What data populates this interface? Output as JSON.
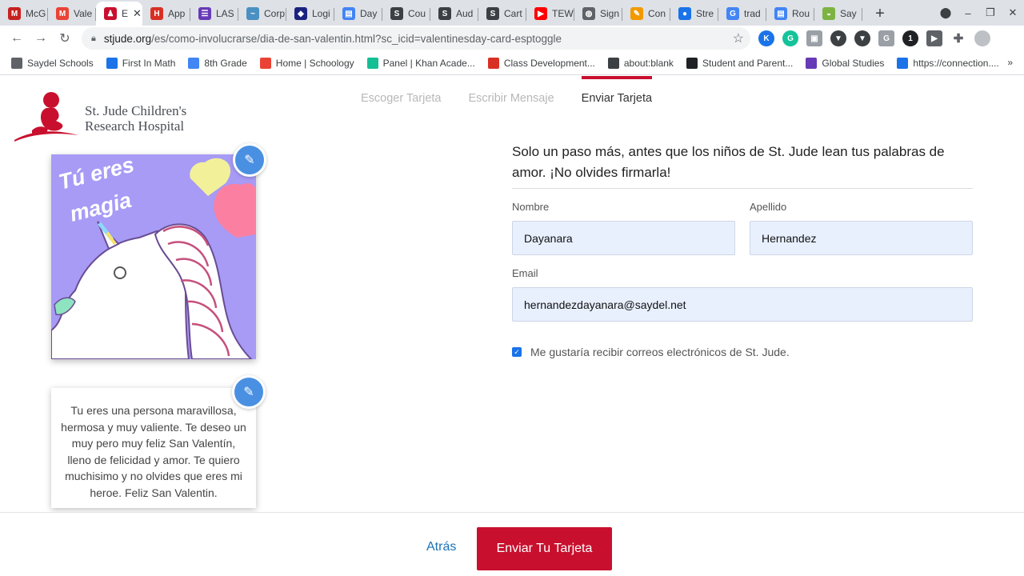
{
  "browser": {
    "tabs": [
      {
        "label": "McG",
        "icon": "mcgraw-icon",
        "color": "#c5221f",
        "glyph": "M"
      },
      {
        "label": "Vale",
        "icon": "gmail-icon",
        "color": "#ea4335",
        "glyph": "M"
      },
      {
        "label": "E",
        "icon": "stjude-icon",
        "color": "#c8102e",
        "glyph": "♟",
        "active": true
      },
      {
        "label": "App",
        "icon": "app-icon",
        "color": "#d93025",
        "glyph": "H"
      },
      {
        "label": "LAS",
        "icon": "list-icon",
        "color": "#673ab7",
        "glyph": "☰"
      },
      {
        "label": "Corp",
        "icon": "corp-icon",
        "color": "#4a90c2",
        "glyph": "~"
      },
      {
        "label": "Logi",
        "icon": "login-icon",
        "color": "#1a237e",
        "glyph": "◆"
      },
      {
        "label": "Day",
        "icon": "docs-icon",
        "color": "#4285f4",
        "glyph": "▤"
      },
      {
        "label": "Cou",
        "icon": "schoology-icon",
        "color": "#3c4043",
        "glyph": "S"
      },
      {
        "label": "Aud",
        "icon": "schoology-icon",
        "color": "#3c4043",
        "glyph": "S"
      },
      {
        "label": "Cart",
        "icon": "schoology-icon",
        "color": "#3c4043",
        "glyph": "S"
      },
      {
        "label": "TEW",
        "icon": "youtube-icon",
        "color": "#ff0000",
        "glyph": "▶"
      },
      {
        "label": "Sign",
        "icon": "globe-icon",
        "color": "#5f6368",
        "glyph": "◍"
      },
      {
        "label": "Con",
        "icon": "pencil-icon",
        "color": "#f29900",
        "glyph": "✎"
      },
      {
        "label": "Stre",
        "icon": "stream-icon",
        "color": "#1a73e8",
        "glyph": "●"
      },
      {
        "label": "trad",
        "icon": "google-icon",
        "color": "#4285f4",
        "glyph": "G"
      },
      {
        "label": "Rou",
        "icon": "docs-icon",
        "color": "#4285f4",
        "glyph": "▤"
      },
      {
        "label": "Say",
        "icon": "saydel-icon",
        "color": "#7cb342",
        "glyph": "◒"
      }
    ],
    "url_domain": "stjude.org",
    "url_path": "/es/como-involucrarse/dia-de-san-valentin.html?sc_icid=valentinesday-card-esptoggle",
    "bookmarks": [
      {
        "label": "Saydel Schools",
        "color": "#5f6368"
      },
      {
        "label": "First In Math",
        "color": "#1a73e8"
      },
      {
        "label": "8th Grade",
        "color": "#4285f4"
      },
      {
        "label": "Home | Schoology",
        "color": "#ea4335"
      },
      {
        "label": "Panel | Khan Acade...",
        "color": "#14bf96"
      },
      {
        "label": "Class Development...",
        "color": "#d93025"
      },
      {
        "label": "about:blank",
        "color": "#3c4043"
      },
      {
        "label": "Student and Parent...",
        "color": "#202124"
      },
      {
        "label": "Global Studies",
        "color": "#673ab7"
      },
      {
        "label": "https://connection....",
        "color": "#1a73e8"
      }
    ]
  },
  "steps": [
    "Escoger Tarjeta",
    "Escribir Mensaje",
    "Enviar Tarjeta"
  ],
  "logo": {
    "line1": "St. Jude Children's",
    "line2": "Research Hospital"
  },
  "card": {
    "line1": "Tú eres",
    "line2": "magia",
    "message": "Tu eres una persona maravillosa, hermosa y muy valiente. Te deseo un muy pero muy feliz San Valentín, lleno de felicidad y amor. Te quiero muchisimo y no olvides que eres mi heroe. Feliz San Valentin."
  },
  "form": {
    "title": "Solo un paso más, antes que los niños de St. Jude lean tus palabras de amor. ¡No olvides firmarla!",
    "first_name_label": "Nombre",
    "first_name": "Dayanara",
    "last_name_label": "Apellido",
    "last_name": "Hernandez",
    "email_label": "Email",
    "email": "hernandezdayanara@saydel.net",
    "optin_label": "Me gustaría recibir correos electrónicos de St. Jude."
  },
  "footer": {
    "back": "Atrás",
    "send": "Enviar Tu Tarjeta"
  },
  "colors": {
    "brand_red": "#c8102e",
    "link_blue": "#1a73b8",
    "card_purple": "#a79bf6"
  }
}
